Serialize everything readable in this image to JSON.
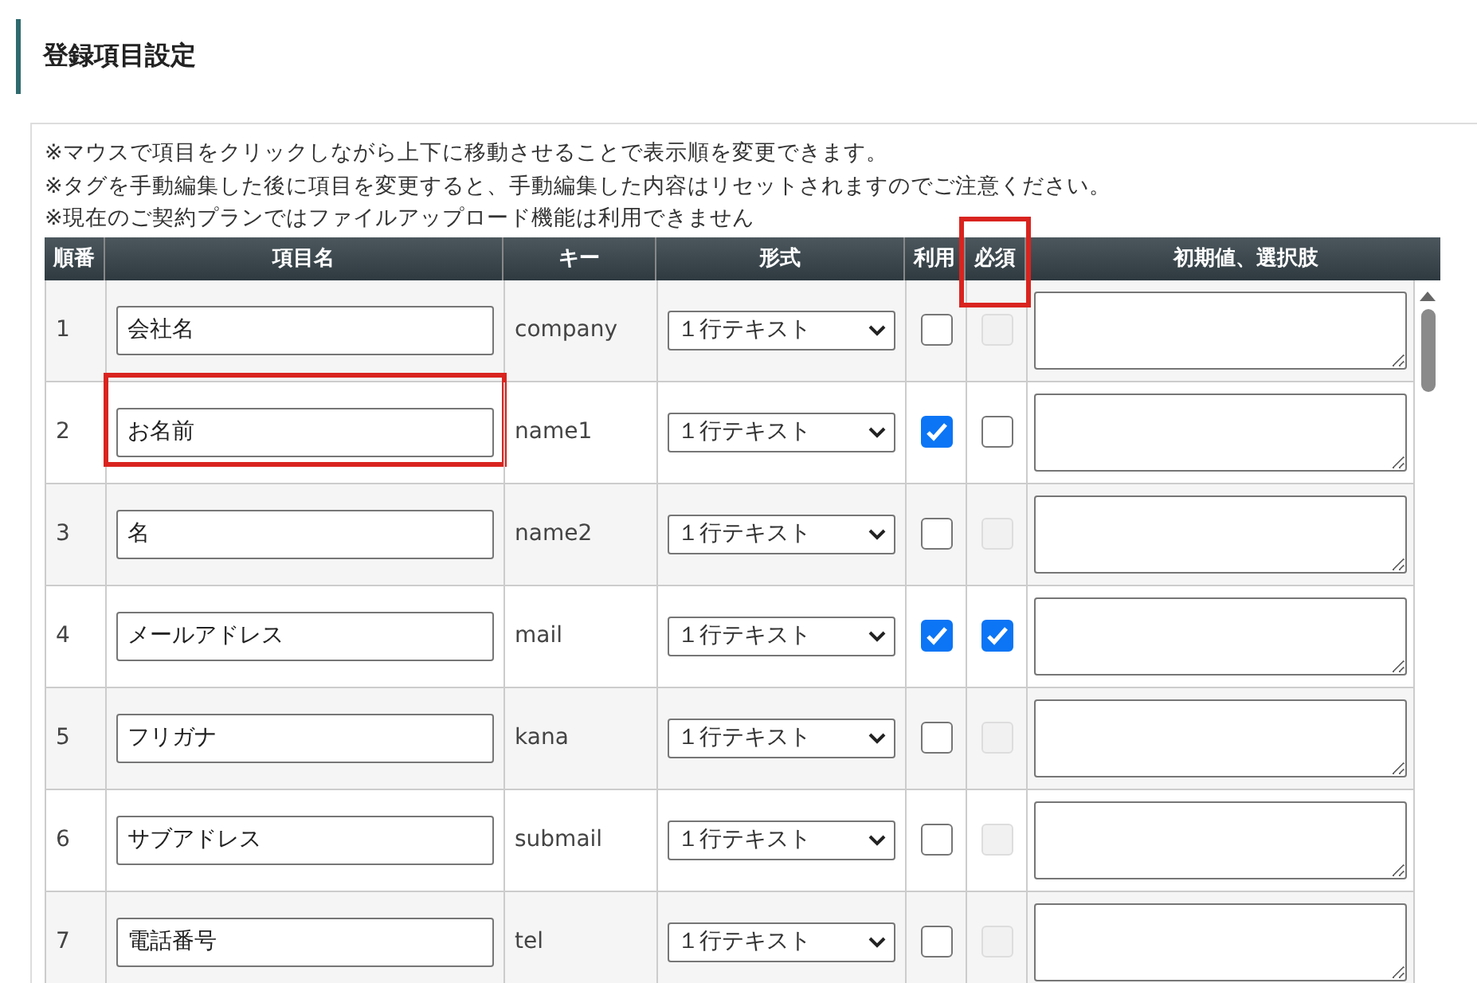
{
  "heading": "登録項目設定",
  "notes": [
    "※マウスで項目をクリックしながら上下に移動させることで表示順を変更できます。",
    "※タグを手動編集した後に項目を変更すると、手動編集した内容はリセットされますのでご注意ください。",
    "※現在のご契約プランではファイルアップロード機能は利用できません"
  ],
  "columns": [
    {
      "label": "順番",
      "highlighted": false
    },
    {
      "label": "項目名",
      "highlighted": false
    },
    {
      "label": "キー",
      "highlighted": false
    },
    {
      "label": "形式",
      "highlighted": false
    },
    {
      "label": "利用",
      "highlighted": false
    },
    {
      "label": "必須",
      "highlighted": true
    },
    {
      "label": "初期値、選択肢",
      "highlighted": false
    }
  ],
  "rows": [
    {
      "order": "1",
      "name": "会社名",
      "name_highlighted": false,
      "key": "company",
      "format": "１行テキスト",
      "use_checked": false,
      "required_checked": false,
      "required_disabled": true
    },
    {
      "order": "2",
      "name": "お名前",
      "name_highlighted": true,
      "key": "name1",
      "format": "１行テキスト",
      "use_checked": true,
      "required_checked": false,
      "required_disabled": false
    },
    {
      "order": "3",
      "name": "名",
      "name_highlighted": false,
      "key": "name2",
      "format": "１行テキスト",
      "use_checked": false,
      "required_checked": false,
      "required_disabled": true
    },
    {
      "order": "4",
      "name": "メールアドレス",
      "name_highlighted": false,
      "key": "mail",
      "format": "１行テキスト",
      "use_checked": true,
      "required_checked": true,
      "required_disabled": false
    },
    {
      "order": "5",
      "name": "フリガナ",
      "name_highlighted": false,
      "key": "kana",
      "format": "１行テキスト",
      "use_checked": false,
      "required_checked": false,
      "required_disabled": true
    },
    {
      "order": "6",
      "name": "サブアドレス",
      "name_highlighted": false,
      "key": "submail",
      "format": "１行テキスト",
      "use_checked": false,
      "required_checked": false,
      "required_disabled": true
    },
    {
      "order": "7",
      "name": "電話番号",
      "name_highlighted": false,
      "key": "tel",
      "format": "１行テキスト",
      "use_checked": false,
      "required_checked": false,
      "required_disabled": true
    }
  ]
}
